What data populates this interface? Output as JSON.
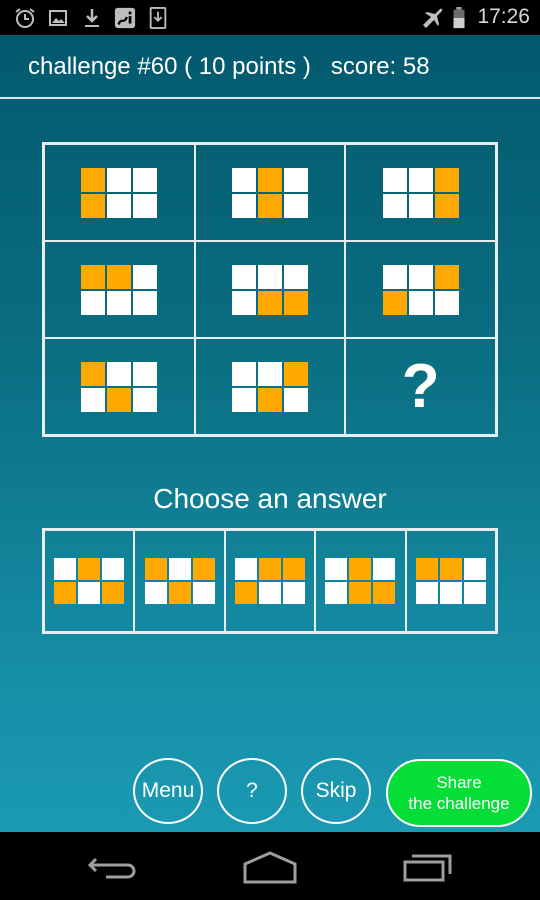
{
  "status_bar": {
    "left_icons": [
      "alarm-icon",
      "image-icon",
      "download-icon",
      "app-notification-icon",
      "download-phone-icon"
    ],
    "right_icons": [
      "airplane-mode-icon",
      "battery-icon"
    ],
    "time": "17:26"
  },
  "header": {
    "title": "challenge #60 ( 10 points )   score: 58"
  },
  "puzzle": {
    "colors": {
      "filled": "#ffa800",
      "empty": "#ffffff"
    },
    "cells": [
      {
        "pattern": [
          1,
          0,
          0,
          1,
          0,
          0
        ]
      },
      {
        "pattern": [
          0,
          1,
          0,
          0,
          1,
          0
        ]
      },
      {
        "pattern": [
          0,
          0,
          1,
          0,
          0,
          1
        ]
      },
      {
        "pattern": [
          1,
          1,
          0,
          0,
          0,
          0
        ]
      },
      {
        "pattern": [
          0,
          0,
          0,
          0,
          1,
          1
        ]
      },
      {
        "pattern": [
          0,
          0,
          1,
          1,
          0,
          0
        ]
      },
      {
        "pattern": [
          1,
          0,
          0,
          0,
          1,
          0
        ]
      },
      {
        "pattern": [
          0,
          0,
          1,
          0,
          1,
          0
        ]
      },
      {
        "unknown": true,
        "label": "?"
      }
    ]
  },
  "answers": {
    "title": "Choose an answer",
    "options": [
      {
        "pattern": [
          0,
          1,
          0,
          1,
          0,
          1
        ]
      },
      {
        "pattern": [
          1,
          0,
          1,
          0,
          1,
          0
        ]
      },
      {
        "pattern": [
          0,
          1,
          1,
          1,
          0,
          0
        ]
      },
      {
        "pattern": [
          0,
          1,
          0,
          0,
          1,
          1
        ]
      },
      {
        "pattern": [
          1,
          1,
          0,
          0,
          0,
          0
        ]
      }
    ]
  },
  "buttons": {
    "menu": "Menu",
    "help": "?",
    "skip": "Skip",
    "share_line1": "Share",
    "share_line2": "the challenge"
  },
  "nav_bar": {
    "items": [
      "back-icon",
      "home-icon",
      "recent-apps-icon"
    ]
  }
}
